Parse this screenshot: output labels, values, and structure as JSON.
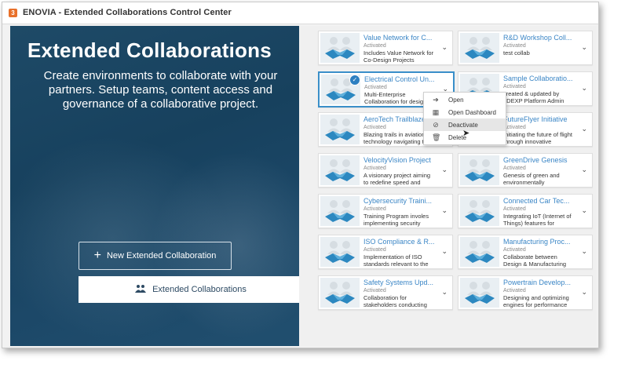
{
  "window": {
    "title": "ENOVIA - Extended Collaborations Control Center",
    "app_icon": "3d-logo-icon"
  },
  "hero": {
    "title": "Extended Collaborations",
    "description": "Create environments to collaborate with your partners. Setup teams, content access and governance of a collaborative project.",
    "new_button_label": "New Extended Collaboration",
    "ec_button_label": "Extended Collaborations"
  },
  "cards": [
    {
      "name": "Value Network for C...",
      "status": "Activated",
      "desc": "Includes Value Network for Co-Design Projects"
    },
    {
      "name": "R&D Workshop Coll...",
      "status": "Activated",
      "desc": "test collab"
    },
    {
      "name": "Electrical Control Un...",
      "status": "Activated",
      "desc": "Multi-Enterprise Collaboration for desig"
    },
    {
      "name": "Sample Collaboratio...",
      "status": "Activated",
      "desc": "created & updated by 3DEXP Platform Admin"
    },
    {
      "name": "AeroTech Trailblaze",
      "status": "Activated",
      "desc": "Blazing trails in aviation technology navigating t"
    },
    {
      "name": "FutureFlyer Initiative",
      "status": "Activated",
      "desc": "Initiating the future of flight through innovative"
    },
    {
      "name": "VelocityVision Project",
      "status": "Activated",
      "desc": "A visionary project aiming to redefine speed and"
    },
    {
      "name": "GreenDrive Genesis",
      "status": "Activated",
      "desc": "Genesis of green and environmentally"
    },
    {
      "name": "Cybersecurity Traini...",
      "status": "Activated",
      "desc": "Training Program involes implementing security"
    },
    {
      "name": "Connected Car Tec...",
      "status": "Activated",
      "desc": "Integrating IoT (Internet of Things) features for"
    },
    {
      "name": "ISO Compliance & R...",
      "status": "Activated",
      "desc": "Implementation of ISO standards relevant to the"
    },
    {
      "name": "Manufacturing Proc...",
      "status": "Activated",
      "desc": "Collaborate between Design & Manufacturing"
    },
    {
      "name": "Safety Systems Upd...",
      "status": "Activated",
      "desc": "Collaboration for stakeholders conducting"
    },
    {
      "name": "Powertrain Develop...",
      "status": "Activated",
      "desc": "Designing and optimizing engines for performance"
    }
  ],
  "context_menu": {
    "items": [
      {
        "label": "Open",
        "icon": "open-arrow-icon"
      },
      {
        "label": "Open Dashboard",
        "icon": "dashboard-grid-icon"
      },
      {
        "label": "Deactivate",
        "icon": "deactivate-icon"
      },
      {
        "label": "Delete",
        "icon": "trash-icon"
      }
    ]
  },
  "colors": {
    "accent": "#3b86c6",
    "hero_bg": "#1b4562",
    "selected_border": "#3a8fc9"
  }
}
